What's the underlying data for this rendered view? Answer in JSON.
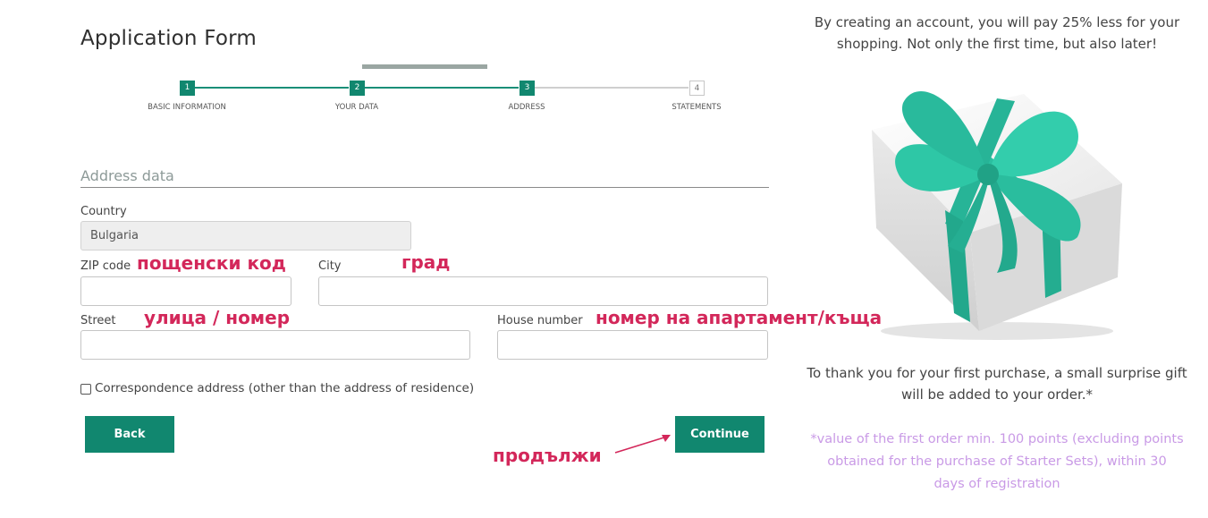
{
  "form": {
    "title": "Application Form",
    "steps": [
      {
        "number": "1",
        "label": "BASIC INFORMATION",
        "state": "done"
      },
      {
        "number": "2",
        "label": "YOUR DATA",
        "state": "done"
      },
      {
        "number": "3",
        "label": "ADDRESS",
        "state": "done"
      },
      {
        "number": "4",
        "label": "STATEMENTS",
        "state": "todo"
      }
    ],
    "section_title": "Address data",
    "country_label": "Country",
    "country_value": "Bulgaria",
    "zip_label": "ZIP code",
    "zip_value": "",
    "city_label": "City",
    "city_value": "",
    "street_label": "Street",
    "street_value": "",
    "house_label": "House number",
    "house_value": "",
    "correspondence_label": "Correspondence address (other than the address of residence)",
    "back_label": "Back",
    "continue_label": "Continue"
  },
  "annotations": {
    "zip": "пощенски код",
    "city": "град",
    "street": "улица / номер",
    "house": "номер на апартамент/къща",
    "continue": "продължи"
  },
  "promo": {
    "top_line1": "By creating an account, you will pay 25% less for your",
    "top_line2": "shopping. Not only the first time, but also later!",
    "gift_icon": "gift-box-with-ribbon",
    "thanks_line1": "To thank you for your first purchase, a small surprise gift",
    "thanks_line2": "will be added to your order.*",
    "note_line1": "*value of the first order min. 100 points (excluding points",
    "note_line2": "obtained for the purchase of Starter Sets), within 30",
    "note_line3": "days of registration"
  },
  "colors": {
    "primary": "#11876f",
    "annotation": "#d3275a",
    "note": "#c99ae6",
    "ribbon": "#2bbfa0"
  }
}
